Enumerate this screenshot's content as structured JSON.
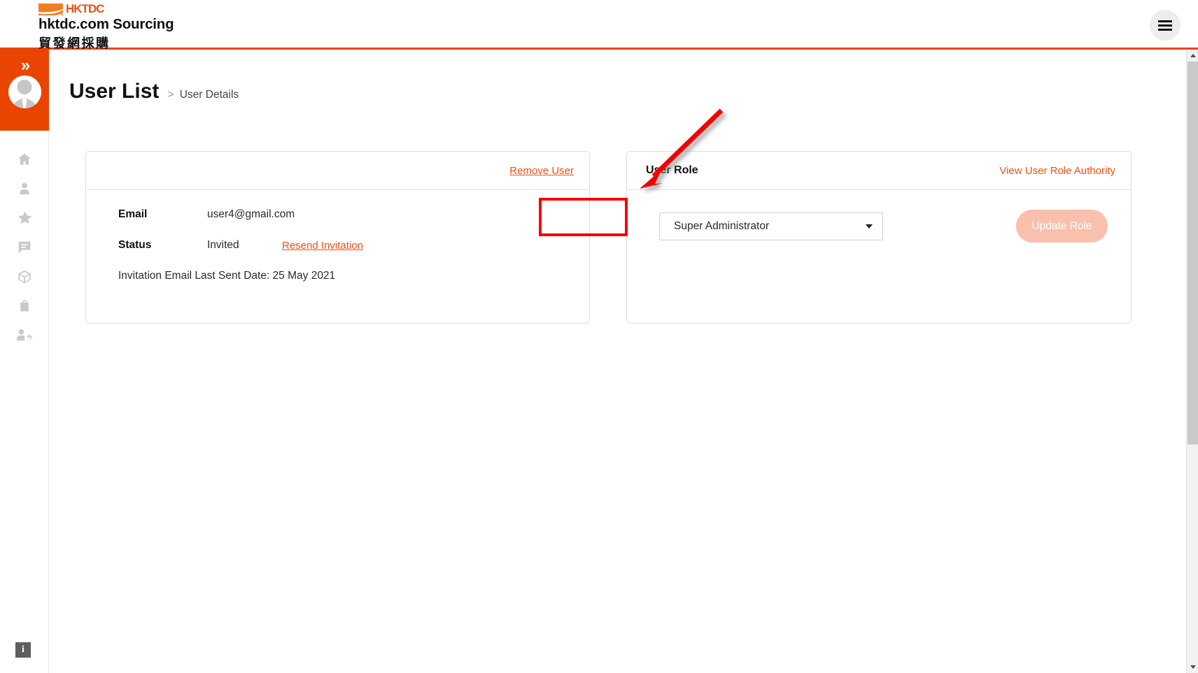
{
  "brand": {
    "logo_icon": "hktdc-logo-icon",
    "logo_word": "HKTDC",
    "title": "hktdc.com Sourcing",
    "subtitle": "貿發網採購"
  },
  "header": {
    "menu_icon": "hamburger-menu-icon"
  },
  "sidebar": {
    "collapse_icon": "double-chevron-right-icon",
    "avatar_icon": "user-avatar-icon",
    "items": [
      {
        "icon": "home-icon",
        "label": "Home"
      },
      {
        "icon": "person-icon",
        "label": "Profile"
      },
      {
        "icon": "star-icon",
        "label": "Favourites"
      },
      {
        "icon": "chat-icon",
        "label": "Messages"
      },
      {
        "icon": "box-icon",
        "label": "Products"
      },
      {
        "icon": "shopping-bag-icon",
        "label": "Orders"
      },
      {
        "icon": "user-settings-icon",
        "label": "User Management"
      }
    ],
    "info_icon": "info-icon",
    "info_label": "i"
  },
  "page": {
    "title": "User List",
    "breadcrumb_separator": ">",
    "breadcrumb_current": "User Details"
  },
  "user_card": {
    "remove_user_link": "Remove User",
    "fields": [
      {
        "label": "Email",
        "value": "user4@gmail.com"
      },
      {
        "label": "Status",
        "value": "Invited"
      }
    ],
    "resend_link": "Resend Invitation",
    "last_sent_note": "Invitation Email Last Sent Date: 25 May 2021"
  },
  "role_card": {
    "title": "User Role",
    "view_authority_link": "View User Role Authority",
    "selected_role": "Super Administrator",
    "role_options": [
      "Super Administrator"
    ],
    "dropdown_icon": "chevron-down-icon",
    "update_button": "Update Role"
  },
  "annotations": {
    "highlight_target": "Remove User",
    "arrow_icon": "red-arrow-icon",
    "highlight_color": "#F40000"
  },
  "scrollbar": {
    "up_icon": "scroll-up-icon",
    "down_icon": "scroll-down-icon"
  },
  "colors": {
    "brand_orange": "#EA4403",
    "link_orange": "#EE5013",
    "logo_orange": "#F07F22",
    "disabled_button": "#F8C0AD",
    "annotation_red": "#F40000"
  }
}
